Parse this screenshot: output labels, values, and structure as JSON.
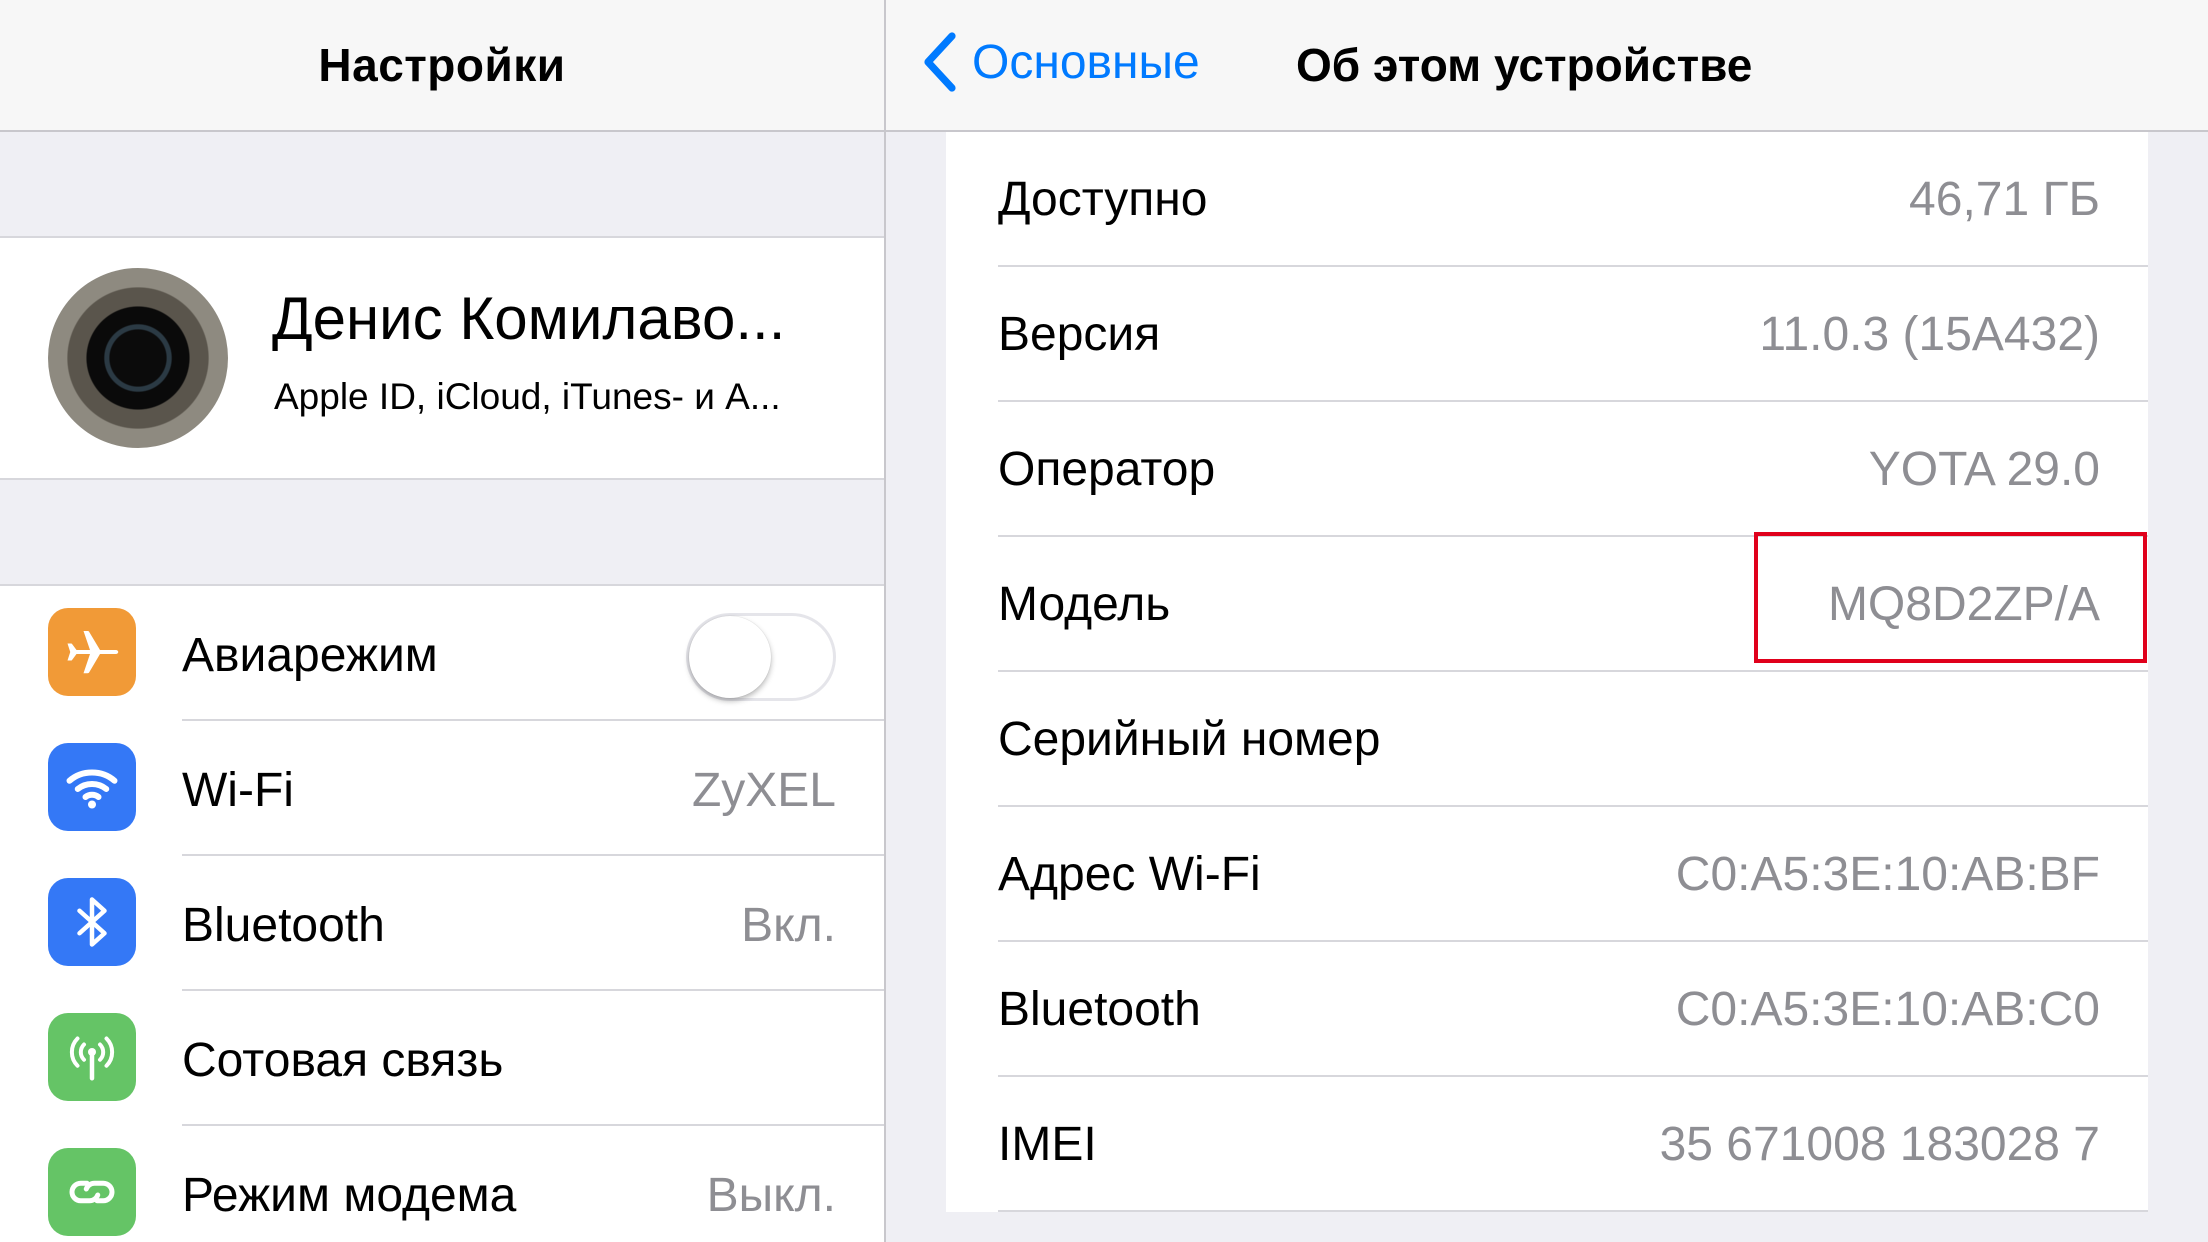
{
  "colors": {
    "accent": "#007aff",
    "secondary_text": "#8e8e93",
    "highlight": "#e0001b",
    "airplane_icon_bg": "#f19a37",
    "wifi_icon_bg": "#3478f6",
    "bluetooth_icon_bg": "#3478f6",
    "cellular_icon_bg": "#65c466",
    "hotspot_icon_bg": "#65c466"
  },
  "left": {
    "title": "Настройки",
    "profile": {
      "name": "Денис Комилаво...",
      "subtitle": "Apple ID, iCloud, iTunes- и A..."
    },
    "items": [
      {
        "label": "Авиарежим",
        "icon": "airplane-icon",
        "toggle": "off"
      },
      {
        "label": "Wi-Fi",
        "value": "ZyXEL",
        "icon": "wifi-icon"
      },
      {
        "label": "Bluetooth",
        "value": "Вкл.",
        "icon": "bluetooth-icon"
      },
      {
        "label": "Сотовая связь",
        "icon": "cellular-icon"
      },
      {
        "label": "Режим модема",
        "value": "Выкл.",
        "icon": "hotspot-icon"
      }
    ]
  },
  "right": {
    "back_label": "Основные",
    "title": "Об этом устройстве",
    "rows": [
      {
        "label": "Доступно",
        "value": "46,71 ГБ"
      },
      {
        "label": "Версия",
        "value": "11.0.3 (15A432)"
      },
      {
        "label": "Оператор",
        "value": "YOTA 29.0"
      },
      {
        "label": "Модель",
        "value": "MQ8D2ZP/A"
      },
      {
        "label": "Серийный номер",
        "value": ""
      },
      {
        "label": "Адрес Wi-Fi",
        "value": "C0:A5:3E:10:AB:BF"
      },
      {
        "label": "Bluetooth",
        "value": "C0:A5:3E:10:AB:C0"
      },
      {
        "label": "IMEI",
        "value": "35 671008 183028 7"
      }
    ]
  }
}
